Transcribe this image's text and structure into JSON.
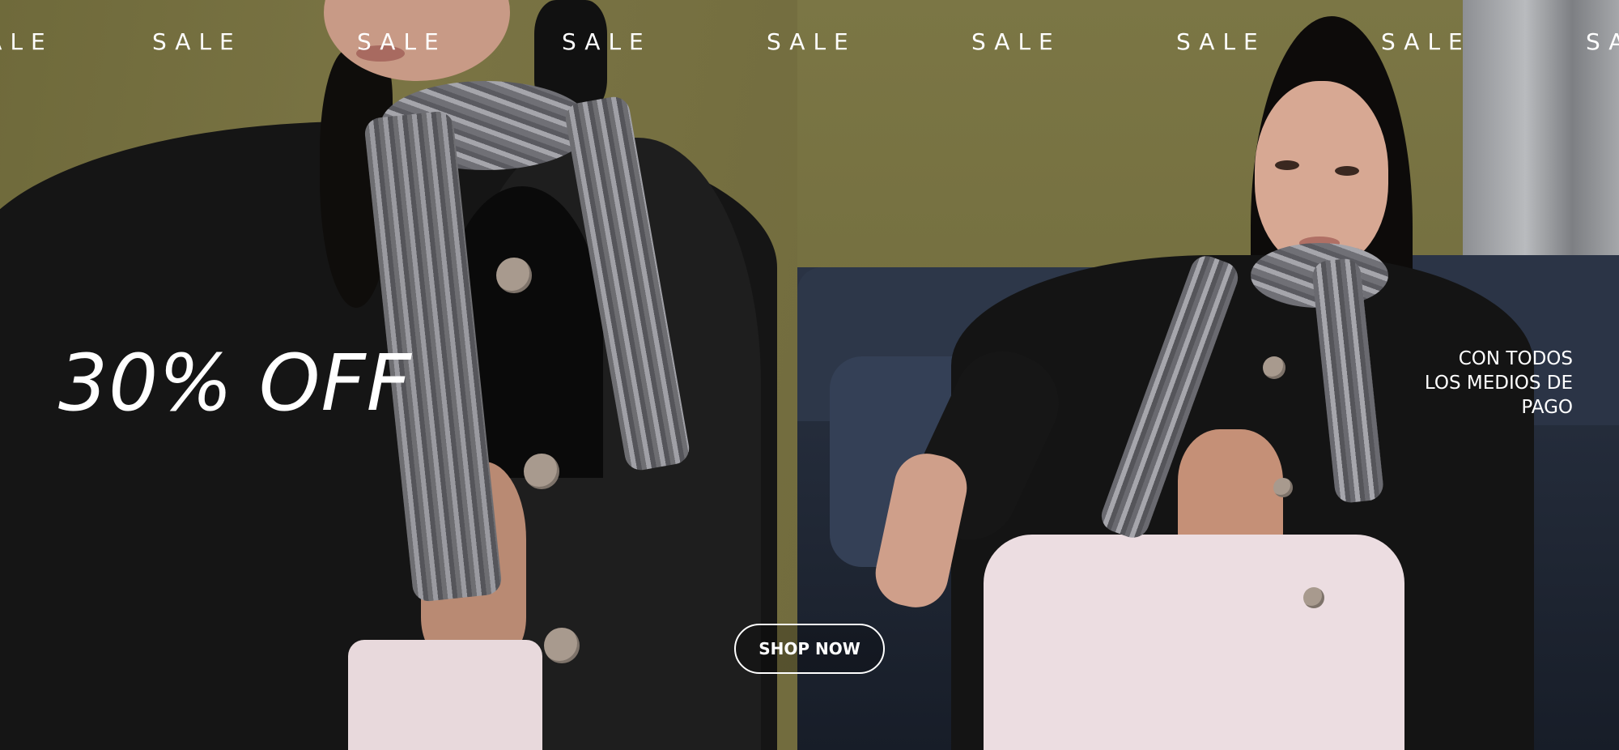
{
  "banner": {
    "marquee_word": "SALE",
    "marquee": [
      "SALE",
      "SALE",
      "SALE",
      "SALE",
      "SALE",
      "SALE",
      "SALE",
      "SALE",
      "SALE"
    ],
    "headline": "30% OFF",
    "subtext_lines": [
      "CON TODOS",
      "LOS MEDIOS DE",
      "PAGO"
    ],
    "cta_label": "SHOP NOW"
  },
  "colors": {
    "text": "#ffffff",
    "background_olive": "#777242",
    "sofa_blue": "#222a38"
  }
}
